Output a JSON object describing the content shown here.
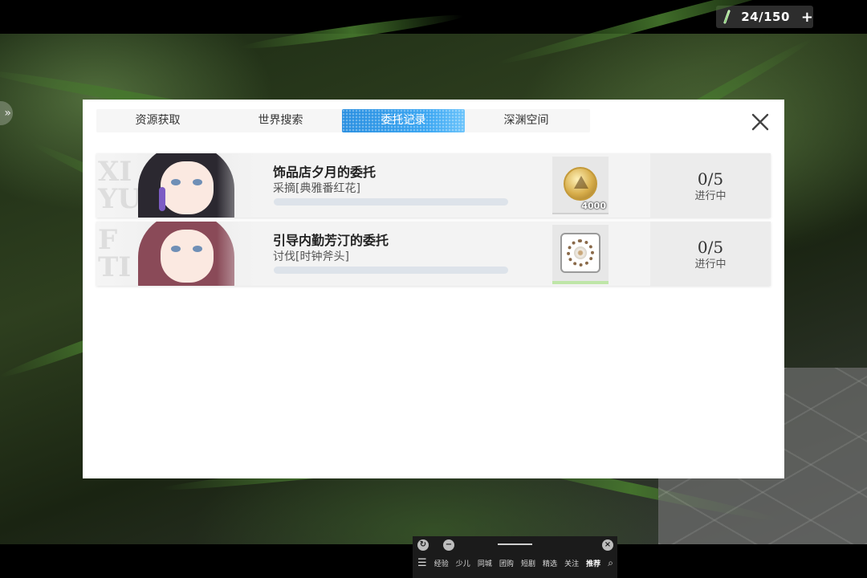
{
  "topbar": {
    "energy_icon": "energy-battery-icon",
    "counter": "24/150",
    "plus": "+"
  },
  "side_handle_icon": "double-chevron-right-icon",
  "panel": {
    "tabs": [
      {
        "label": "资源获取",
        "active": false
      },
      {
        "label": "世界搜索",
        "active": false
      },
      {
        "label": "委托记录",
        "active": true
      },
      {
        "label": "深渊空间",
        "active": false
      }
    ],
    "close_icon": "close-icon",
    "commissions": [
      {
        "portrait_letters": "XI\nYU",
        "title": "饰品店夕月的委托",
        "subtitle": "采摘[典雅番红花]",
        "progress": 0,
        "reward_icon": "gold-coin-icon",
        "reward_qty": "4000",
        "count": "0/5",
        "status": "进行中"
      },
      {
        "portrait_letters": "F\nTI",
        "title": "引导内勤芳汀的委托",
        "subtitle": "讨伐[时钟斧头]",
        "progress": 0,
        "reward_icon": "clock-flower-item-icon",
        "reward_qty": "",
        "count": "0/5",
        "status": "进行中"
      }
    ]
  },
  "bottombar": {
    "nav": [
      "经验",
      "少儿",
      "同城",
      "团购",
      "短剧",
      "精选",
      "关注",
      "推荐"
    ],
    "current": "推荐"
  },
  "colors": {
    "accent_tab": "#2a8fe0",
    "panel_bg": "#ffffff"
  }
}
